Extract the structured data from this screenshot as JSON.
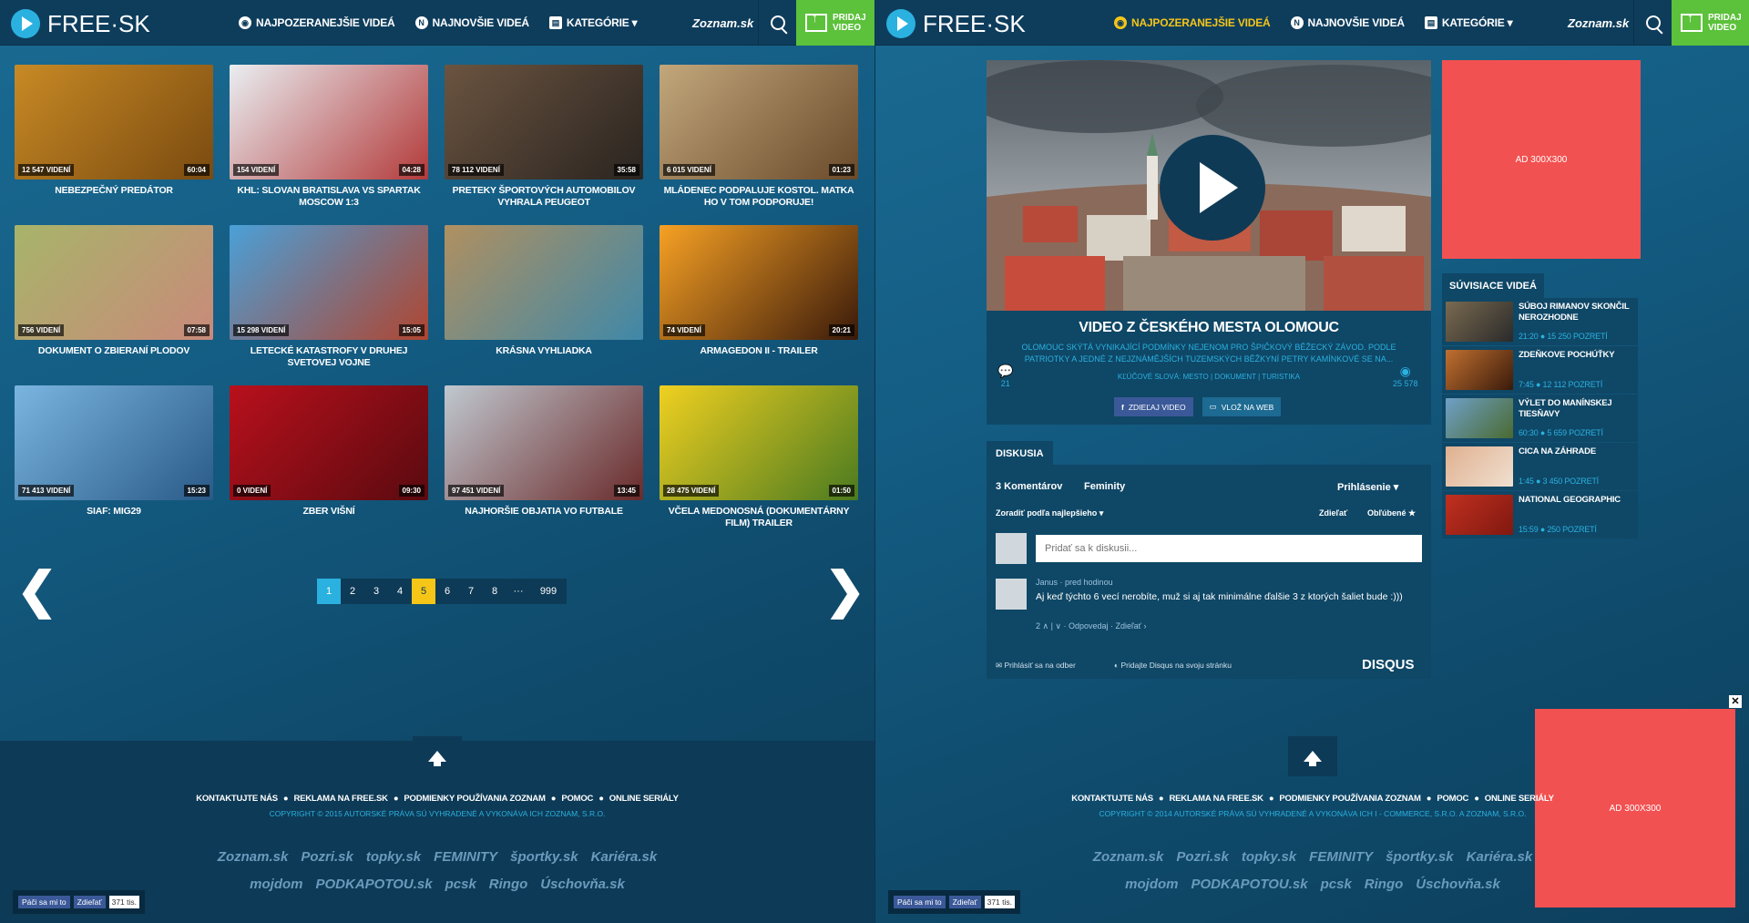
{
  "left": {
    "logo": "FREE·SK",
    "nav": [
      {
        "label": "NAJPOZERANEJŠIE VIDEÁ",
        "icon": "eye-icon",
        "active": false
      },
      {
        "label": "NAJNOVŠIE VIDEÁ",
        "icon": "new-icon",
        "active": false
      },
      {
        "label": "KATEGÓRIE ▾",
        "icon": "folder-icon",
        "active": false
      }
    ],
    "zoznam": "Zoznam.sk",
    "add_video": [
      "PRIDAJ",
      "VIDEO"
    ],
    "videos": [
      {
        "title": "NEBEZPEČNÝ PREDÁTOR",
        "views": "12 547 VIDENÍ",
        "duration": "60:04",
        "colors": [
          "#c88a25",
          "#7a4a10"
        ]
      },
      {
        "title": "KHL: SLOVAN BRATISLAVA VS SPARTAK MOSCOW 1:3",
        "views": "154 VIDENÍ",
        "duration": "04:28",
        "colors": [
          "#e9eef2",
          "#b33a3a"
        ]
      },
      {
        "title": "PRETEKY ŠPORTOVÝCH AUTOMOBILOV VYHRALA PEUGEOT",
        "views": "78 112 VIDENÍ",
        "duration": "35:58",
        "colors": [
          "#6b5440",
          "#2a2420"
        ]
      },
      {
        "title": "MLÁDENEC PODPALUJE KOSTOL. MATKA HO V TOM PODPORUJE!",
        "views": "6 015 VIDENÍ",
        "duration": "01:23",
        "colors": [
          "#c2a77c",
          "#6a4a2a"
        ]
      },
      {
        "title": "DOKUMENT O ZBIERANÍ PLODOV",
        "views": "756 VIDENÍ",
        "duration": "07:58",
        "colors": [
          "#a7b46a",
          "#c98a7a"
        ]
      },
      {
        "title": "LETECKÉ KATASTROFY V DRUHEJ SVETOVEJ VOJNE",
        "views": "15 298 VIDENÍ",
        "duration": "15:05",
        "colors": [
          "#4aa0d8",
          "#b04530"
        ]
      },
      {
        "title": "KRÁSNA VYHLIADKA",
        "views": "",
        "duration": "",
        "colors": [
          "#b09060",
          "#3f88a8"
        ]
      },
      {
        "title": "ARMAGEDON II - TRAILER",
        "views": "74 VIDENÍ",
        "duration": "20:21",
        "colors": [
          "#f7a124",
          "#3a1a0a"
        ]
      },
      {
        "title": "SIAF: MIG29",
        "views": "71 413 VIDENÍ",
        "duration": "15:23",
        "colors": [
          "#7ab5e0",
          "#2a5a88"
        ]
      },
      {
        "title": "ZBER VIŠNÍ",
        "views": "0 VIDENÍ",
        "duration": "09:30",
        "colors": [
          "#b8101c",
          "#5a0a10"
        ]
      },
      {
        "title": "NAJHORŠIE OBJATIA VO FUTBALE",
        "views": "97 451 VIDENÍ",
        "duration": "13:45",
        "colors": [
          "#c0c8d0",
          "#6a2a2a"
        ]
      },
      {
        "title": "VČELA MEDONOSNÁ (DOKUMENTÁRNY FILM) TRAILER",
        "views": "28 475 VIDENÍ",
        "duration": "01:50",
        "colors": [
          "#f0d020",
          "#4a7a20"
        ]
      }
    ],
    "pager": [
      "1",
      "2",
      "3",
      "4",
      "5",
      "6",
      "7",
      "8",
      "···",
      "999"
    ],
    "pager_current": "1",
    "pager_highlight": "5",
    "prev_arrow": "❮",
    "next_arrow": "❯"
  },
  "right": {
    "logo": "FREE·SK",
    "nav": [
      {
        "label": "NAJPOZERANEJŠIE VIDEÁ",
        "icon": "eye-icon",
        "active": true
      },
      {
        "label": "NAJNOVŠIE VIDEÁ",
        "icon": "new-icon",
        "active": false
      },
      {
        "label": "KATEGÓRIE ▾",
        "icon": "folder-icon",
        "active": false
      }
    ],
    "zoznam": "Zoznam.sk",
    "add_video": [
      "PRIDAJ",
      "VIDEO"
    ],
    "video_title": "VIDEO Z ČESKÉHO MESTA OLOMOUC",
    "video_desc": "OLOMOUC SKÝTÁ VYNIKAJÍCÍ PODMÍNKY NEJENOM PRO ŠPIČKOVÝ BĚŽECKÝ ZÁVOD. PODLE PATRIOTKY A JEDNÉ Z NEJZNÁMĚJŠÍCH TUZEMSKÝCH BĚŽKYNÍ PETRY KAMÍNKOVÉ SE NA...",
    "keywords": "KĽÚČOVÉ SLOVÁ: MESTO | DOKUMENT | TURISTIKA",
    "comment_count": "21",
    "view_count": "25 578",
    "share_label": "ZDIEĽAJ VIDEO",
    "embed_label": "VLOŽ NA WEB",
    "disq": {
      "section_label": "DISKUSIA",
      "tab_comments": "3 Komentárov",
      "tab_site": "Feminity",
      "login": "Prihlásenie ▾",
      "sort": "Zoradiť podľa najlepšieho ▾",
      "share": "Zdieľať",
      "fav": "Obľúbené ★",
      "input_placeholder": "Pridať sa k diskusii...",
      "comment_author": "Janus",
      "comment_time": "pred hodinou",
      "comment_text": "Aj keď týchto 6 vecí nerobíte, muž si aj tak minimálne ďalšie 3 z ktorých šaliet bude :)))",
      "comment_actions": "2 ∧ | ∨ · Odpovedaj · Zdieľať ›",
      "subscribe": "Prihlásiť sa na odber",
      "add_disqus": "Pridajte Disqus na svoju stránku",
      "brand": "DISQUS"
    },
    "ad_top": "AD 300X300",
    "ad_bottom": "AD 300X300",
    "close": "✕",
    "related_label": "SÚVISIACE VIDEÁ",
    "related": [
      {
        "title": "SÚBOJ RIMANOV SKONČIL NEROZHODNE",
        "meta": "21:20 ● 15 250 POZRETÍ",
        "colors": [
          "#7a6a50",
          "#2a2a2a"
        ]
      },
      {
        "title": "ZDEŇKOVE POCHÚŤKY",
        "meta": "7:45 ● 12 112 POZRETÍ",
        "colors": [
          "#c07030",
          "#3a1a0a"
        ]
      },
      {
        "title": "VÝLET DO MANÍNSKEJ TIESŇAVY",
        "meta": "60:30 ● 5 659 POZRETÍ",
        "colors": [
          "#6fa0c8",
          "#4a6a30"
        ]
      },
      {
        "title": "CICA NA ZÁHRADE",
        "meta": "1:45 ● 3 450 POZRETÍ",
        "colors": [
          "#e0b090",
          "#f0e0d0"
        ]
      },
      {
        "title": "NATIONAL GEOGRAPHIC",
        "meta": "15:59 ● 250 POZRETÍ",
        "colors": [
          "#c03020",
          "#801810"
        ]
      }
    ]
  },
  "footer": {
    "links": [
      "KONTAKTUJTE NÁS",
      "REKLAMA NA FREE.SK",
      "PODMIENKY POUŽÍVANIA ZOZNAM",
      "POMOC",
      "ONLINE SERIÁLY"
    ],
    "copyright_left": "COPYRIGHT © 2015 AUTORSKÉ PRÁVA SÚ VYHRADENÉ A VYKONÁVA ICH ZOZNAM, S.R.O.",
    "copyright_right": "COPYRIGHT © 2014 AUTORSKÉ PRÁVA SÚ VYHRADENÉ A VYKONÁVA ICH I - COMMERCE, S.R.O. A ZOZNAM, S.R.O.",
    "partners_row1": [
      "Zoznam.sk",
      "Pozri.sk",
      "topky.sk",
      "FEMINITY",
      "športky.sk",
      "Kariéra.sk"
    ],
    "partners_row2": [
      "mojdom",
      "PODKAPOTOU.sk",
      "pcsk",
      "Ringo",
      "Úschovňa.sk"
    ],
    "fb_like": "Páči sa mi to",
    "fb_share": "Zdieľať",
    "fb_count": "371 tis."
  }
}
